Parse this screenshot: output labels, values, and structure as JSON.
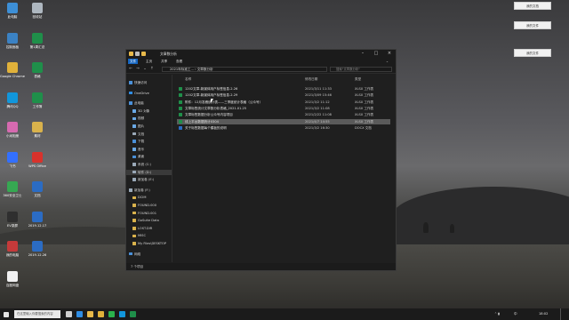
{
  "desktop": {
    "icons": [
      {
        "label": "此电脑",
        "color": "#3d8fd6"
      },
      {
        "label": "回收站",
        "color": "#aeb7c0"
      },
      {
        "label": "控制面板",
        "color": "#3b82c4"
      },
      {
        "label": "第1周汇总",
        "color": "#1f8f4a"
      },
      {
        "label": "Google Chrome",
        "color": "#e0b13a"
      },
      {
        "label": "表格",
        "color": "#1f8f4a"
      },
      {
        "label": "腾讯QQ",
        "color": "#1296db"
      },
      {
        "label": "工作簿",
        "color": "#1f8f4a"
      },
      {
        "label": "小米相册",
        "color": "#d66ab0"
      },
      {
        "label": "素材",
        "color": "#d9b24c"
      },
      {
        "label": "飞书",
        "color": "#3370ff"
      },
      {
        "label": "WPS Office",
        "color": "#d8322c"
      },
      {
        "label": "360安全卫士",
        "color": "#36a852"
      },
      {
        "label": "文档",
        "color": "#2b6cc4"
      },
      {
        "label": "EV录屏",
        "color": "#2f2f2f"
      },
      {
        "label": "2019.12.17",
        "color": "#2b6cc4"
      },
      {
        "label": "我的电脑",
        "color": "#c53a3a"
      },
      {
        "label": "2019.12.26",
        "color": "#2b6cc4"
      },
      {
        "label": "百度网盘",
        "color": "#f1f1f1"
      }
    ],
    "notes": [
      "我的文档",
      "我的文件",
      "我的文件"
    ]
  },
  "window": {
    "title": "文章数分析",
    "ribbon_tabs": [
      "文件",
      "主页",
      "共享",
      "查看"
    ],
    "path": [
      "2021年标准工...",
      "文章数分析"
    ],
    "search_placeholder": "搜索\"文章数分析\"",
    "nav_items": [
      {
        "label": "快速访问",
        "color": "#4a90d9",
        "selected": false
      },
      {
        "label": "OneDrive",
        "color": "#2f8de4",
        "selected": false
      },
      {
        "label": "此电脑",
        "color": "#4a90d9",
        "selected": false
      },
      {
        "label": "3D 对象",
        "color": "#6aa9e6",
        "selected": false
      },
      {
        "label": "视频",
        "color": "#6aa9e6",
        "selected": false
      },
      {
        "label": "图片",
        "color": "#6aa9e6",
        "selected": false
      },
      {
        "label": "文档",
        "color": "#9aa9b8",
        "selected": false
      },
      {
        "label": "下载",
        "color": "#4a90d9",
        "selected": false
      },
      {
        "label": "音乐",
        "color": "#6aa9e6",
        "selected": false
      },
      {
        "label": "桌面",
        "color": "#4a90d9",
        "selected": false
      },
      {
        "label": "系统 (C:)",
        "color": "#9aa9b8",
        "selected": false
      },
      {
        "label": "软件 (D:)",
        "color": "#9aa9b8",
        "selected": true
      },
      {
        "label": "新加卷 (E:)",
        "color": "#9aa9b8",
        "selected": false
      },
      {
        "label": "新加卷 (F:)",
        "color": "#9aa9b8",
        "selected": false
      },
      {
        "label": "DCIM",
        "color": "#d9b24c",
        "selected": false
      },
      {
        "label": "FOUND.000",
        "color": "#d9b24c",
        "selected": false
      },
      {
        "label": "FOUND.001",
        "color": "#d9b24c",
        "selected": false
      },
      {
        "label": "GoSuite Data",
        "color": "#d9b24c",
        "selected": false
      },
      {
        "label": "LOST.DIR",
        "color": "#d9b24c",
        "selected": false
      },
      {
        "label": "MISC",
        "color": "#d9b24c",
        "selected": false
      },
      {
        "label": "My Files\\DESKTOP",
        "color": "#d9b24c",
        "selected": false
      },
      {
        "label": "网络",
        "color": "#4a90d9",
        "selected": false
      }
    ],
    "columns": {
      "name": "名称",
      "date": "修改日期",
      "type": "类型"
    },
    "files": [
      {
        "name": "1202文章-新媒体用户标签信息-2.26",
        "date": "2021/3/11 11:33",
        "type": "XLSX 工作表",
        "color": "#1f8f4a",
        "selected": false
      },
      {
        "name": "1202文章-新媒体用户标签信息-2.29",
        "date": "2021/3/09 15:46",
        "type": "XLSX 工作表",
        "color": "#1f8f4a",
        "selected": false
      },
      {
        "name": "附件：12月发稿统计表——三季度统计表格（公众号）",
        "date": "2021/3/2 11:12",
        "type": "XLSX 工作表",
        "color": "#1f8f4a",
        "selected": false
      },
      {
        "name": "文章标签统计文章数分析表格_2021.01.25",
        "date": "2021/3/2 11:08",
        "type": "XLSX 工作表",
        "color": "#1f8f4a",
        "selected": false
      },
      {
        "name": "文章标签数据分析公众号内容项目",
        "date": "2021/2/22 11:08",
        "type": "XLSX 工作表",
        "color": "#1f8f4a",
        "selected": false
      },
      {
        "name": "线上平台数据统计0304",
        "date": "2021/4/7 14:55",
        "type": "XLSX 工作表",
        "color": "#1f8f4a",
        "selected": true
      },
      {
        "name": "关于标签数据每个模板的说明",
        "date": "2021/3/2 16:30",
        "type": "DOCX 文档",
        "color": "#2b6cc4",
        "selected": false
      }
    ],
    "status": "7 个项目"
  },
  "taskbar": {
    "search_placeholder": "在这里输入你要搜索的内容",
    "pinned": [
      {
        "name": "task-view",
        "color": "#cfcfcf"
      },
      {
        "name": "edge",
        "color": "#2f8de4"
      },
      {
        "name": "explorer",
        "color": "#e8b94a"
      },
      {
        "name": "chrome",
        "color": "#e0b13a"
      },
      {
        "name": "wechat",
        "color": "#2bb24c"
      },
      {
        "name": "qq",
        "color": "#1296db"
      },
      {
        "name": "excel",
        "color": "#1f8f4a"
      }
    ],
    "tray_text": "中",
    "clock": "18:02"
  }
}
